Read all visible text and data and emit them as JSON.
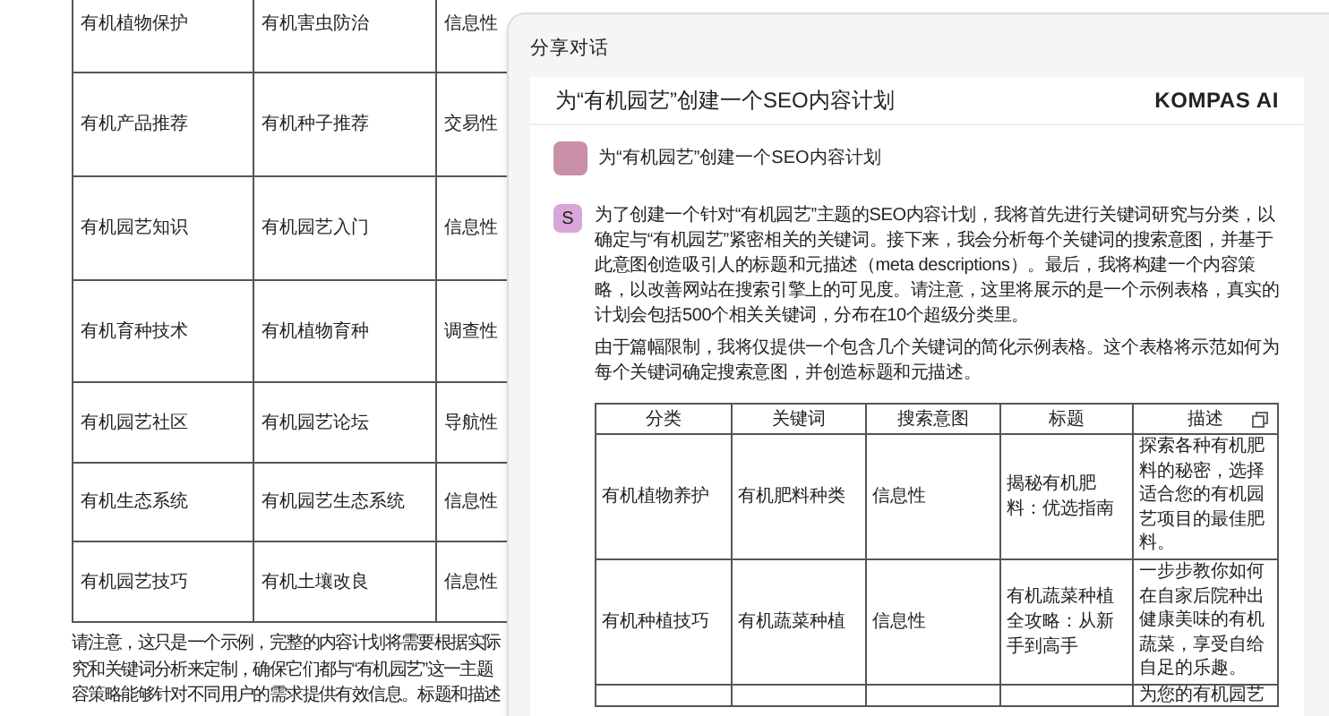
{
  "background_page": {
    "table_rows": [
      [
        "有机植物保护",
        "有机害虫防治",
        "信息性"
      ],
      [
        "有机产品推荐",
        "有机种子推荐",
        "交易性"
      ],
      [
        "有机园艺知识",
        "有机园艺入门",
        "信息性"
      ],
      [
        "有机育种技术",
        "有机植物育种",
        "调查性"
      ],
      [
        "有机园艺社区",
        "有机园艺论坛",
        "导航性"
      ],
      [
        "有机生态系统",
        "有机园艺生态系统",
        "信息性"
      ],
      [
        "有机园艺技巧",
        "有机土壤改良",
        "信息性"
      ]
    ],
    "note_lines": [
      "请注意，这只是一个示例，完整的内容计划将需要根据实际",
      "究和关键词分析来定制，确保它们都与“有机园艺”这一主题",
      "容策略能够针对不同用户的需求提供有效信息。标题和描述"
    ]
  },
  "dialog": {
    "title": "分享对话",
    "card": {
      "title": "为“有机园艺”创建一个SEO内容计划",
      "brand": "KOMPAS AI",
      "messages": [
        {
          "kind": "user",
          "text": "为“有机园艺”创建一个SEO内容计划"
        },
        {
          "kind": "assistant",
          "avatar": "S",
          "paragraphs": [
            "为了创建一个针对“有机园艺”主题的SEO内容计划，我将首先进行关键词研究与分类，以确定与“有机园艺”紧密相关的关键词。接下来，我会分析每个关键词的搜索意图，并基于此意图创造吸引人的标题和元描述（meta descriptions）。最后，我将构建一个内容策略，以改善网站在搜索引擎上的可见度。请注意，这里将展示的是一个示例表格，真实的计划会包括500个相关关键词，分布在10个超级分类里。",
            "由于篇幅限制，我将仅提供一个包含几个关键词的简化示例表格。这个表格将示范如何为每个关键词确定搜索意图，并创造标题和元描述。"
          ],
          "table": {
            "columns": [
              "分类",
              "关键词",
              "搜索意图",
              "标题",
              "描述"
            ],
            "rows": [
              [
                "有机植物养护",
                "有机肥料种类",
                "信息性",
                "揭秘有机肥料：优选指南",
                "探索各种有机肥料的秘密，选择适合您的有机园艺项目的最佳肥料。"
              ],
              [
                "有机种植技巧",
                "有机蔬菜种植",
                "信息性",
                "有机蔬菜种植全攻略：从新手到高手",
                "一步步教你如何在自家后院种出健康美味的有机蔬菜，享受自给自足的乐趣。"
              ],
              [
                "",
                "",
                "",
                "",
                "为您的有机园艺"
              ]
            ]
          }
        }
      ]
    }
  }
}
